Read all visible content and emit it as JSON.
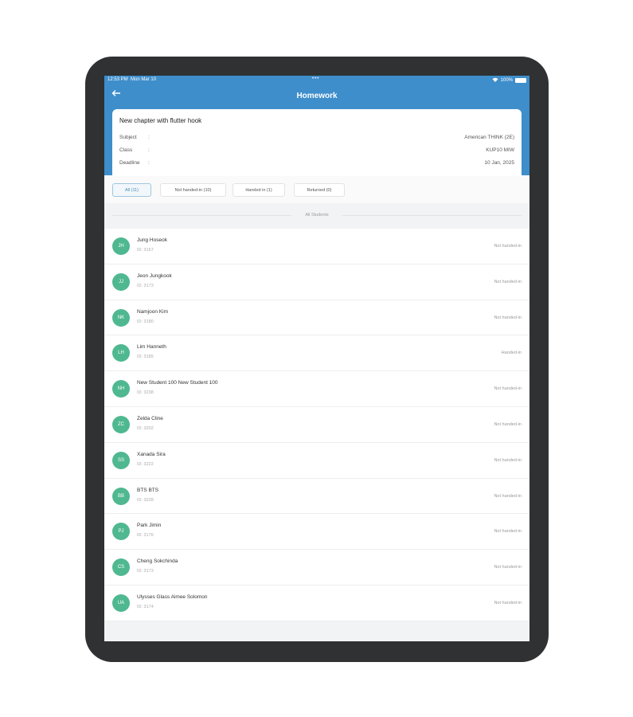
{
  "statusbar": {
    "time": "12:53 PM",
    "date": "Mon Mar 10",
    "dots": "•••",
    "wifi_icon": "wifi-icon",
    "battery": "100%"
  },
  "header": {
    "back_icon": "back-arrow-icon",
    "title": "Homework"
  },
  "homework": {
    "title": "New chapter with flutter hook",
    "fields": [
      {
        "label": "Subject",
        "colon": ":",
        "value": "American THINK (2E)"
      },
      {
        "label": "Class",
        "colon": ":",
        "value": "KUP10 MIW"
      },
      {
        "label": "Deadline",
        "colon": ":",
        "value": "10 Jan, 2025"
      }
    ]
  },
  "filters": [
    {
      "label": "All (11)",
      "active": true
    },
    {
      "label": "Not handed-in (10)",
      "active": false
    },
    {
      "label": "Handed in (1)",
      "active": false
    },
    {
      "label": "Returned (0)",
      "active": false
    }
  ],
  "list_heading": "All Students",
  "students": [
    {
      "initials": "JH",
      "name": "Jung Hoseok",
      "id": "ID: 3167",
      "status": "Not handed-in"
    },
    {
      "initials": "JJ",
      "name": "Jeon Jungkook",
      "id": "ID: 3173",
      "status": "Not handed-in"
    },
    {
      "initials": "NK",
      "name": "Namjoon Kim",
      "id": "ID: 3180",
      "status": "Not handed-in"
    },
    {
      "initials": "LH",
      "name": "Lim Hanneth",
      "id": "ID: 3185",
      "status": "Handed-in"
    },
    {
      "initials": "NH",
      "name": "New Student 100 New Student 100",
      "id": "ID: 3238",
      "status": "Not handed-in"
    },
    {
      "initials": "ZC",
      "name": "Zelda Cline",
      "id": "ID: 3202",
      "status": "Not handed-in"
    },
    {
      "initials": "SS",
      "name": "Xanada Sira",
      "id": "ID: 3222",
      "status": "Not handed-in"
    },
    {
      "initials": "BB",
      "name": "BTS BTS",
      "id": "ID: 3228",
      "status": "Not handed-in"
    },
    {
      "initials": "PJ",
      "name": "Park Jimin",
      "id": "ID: 3176",
      "status": "Not handed-in"
    },
    {
      "initials": "CS",
      "name": "Cheng Sokchinda",
      "id": "ID: 3173",
      "status": "Not handed-in"
    },
    {
      "initials": "UA",
      "name": "Ulysses Glass Aimee Solomon",
      "id": "ID: 3174",
      "status": "Not handed-in"
    }
  ],
  "colors": {
    "brand_blue": "#3e8ecb",
    "avatar_green": "#4fb890",
    "device_frame": "#2f3133"
  }
}
